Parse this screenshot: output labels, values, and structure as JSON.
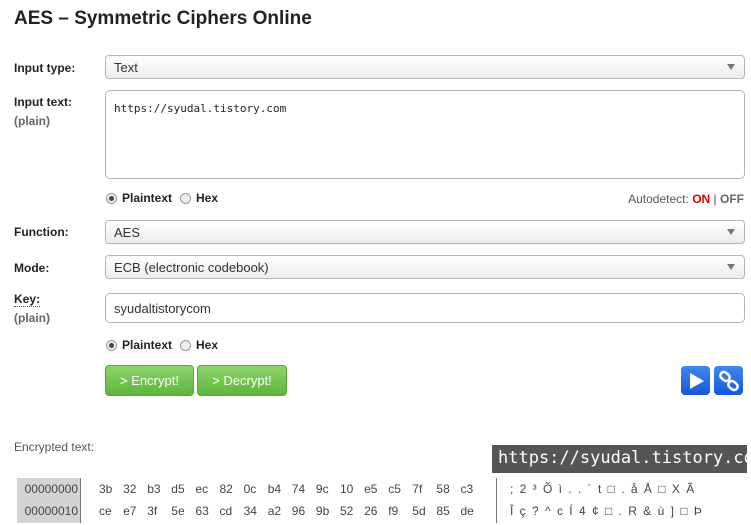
{
  "title": "AES – Symmetric Ciphers Online",
  "input_type": {
    "label": "Input type:",
    "value": "Text"
  },
  "input_text": {
    "label": "Input text:",
    "sub": "(plain)",
    "value": "https://syudal.tistory.com"
  },
  "input_format": {
    "options": [
      "Plaintext",
      "Hex"
    ],
    "selected": "Plaintext"
  },
  "autodetect": {
    "label": "Autodetect:",
    "on": "ON",
    "sep": "|",
    "off": "OFF",
    "state": "ON",
    "on_color": "#e00000"
  },
  "function": {
    "label": "Function:",
    "value": "AES"
  },
  "mode": {
    "label": "Mode:",
    "value": "ECB (electronic codebook)"
  },
  "key": {
    "label": "Key:",
    "sub": "(plain)",
    "value": "syudaltistorycom"
  },
  "key_format": {
    "options": [
      "Plaintext",
      "Hex"
    ],
    "selected": "Plaintext"
  },
  "buttons": {
    "encrypt": "> Encrypt!",
    "decrypt": "> Decrypt!",
    "play_icon": "play-icon",
    "link_icon": "link-icon"
  },
  "watermark": "https://syudal.tistory.com",
  "output": {
    "label": "Encrypted text:",
    "rows": [
      {
        "offset": "00000000",
        "bytes": [
          "3b",
          "32",
          "b3",
          "d5",
          "ec",
          "82",
          "0c",
          "b4",
          "74",
          "9c",
          "10",
          "e5",
          "c5",
          "7f",
          "58",
          "c3"
        ],
        "ascii": "; 2 ³ Õ ì . . ´ t □ . å Å □ X Ã"
      },
      {
        "offset": "00000010",
        "bytes": [
          "ce",
          "e7",
          "3f",
          "5e",
          "63",
          "cd",
          "34",
          "a2",
          "96",
          "9b",
          "52",
          "26",
          "f9",
          "5d",
          "85",
          "de"
        ],
        "ascii": "Î ç ? ^ c Í 4 ¢ □ . R & ù ] □ Þ"
      }
    ]
  }
}
